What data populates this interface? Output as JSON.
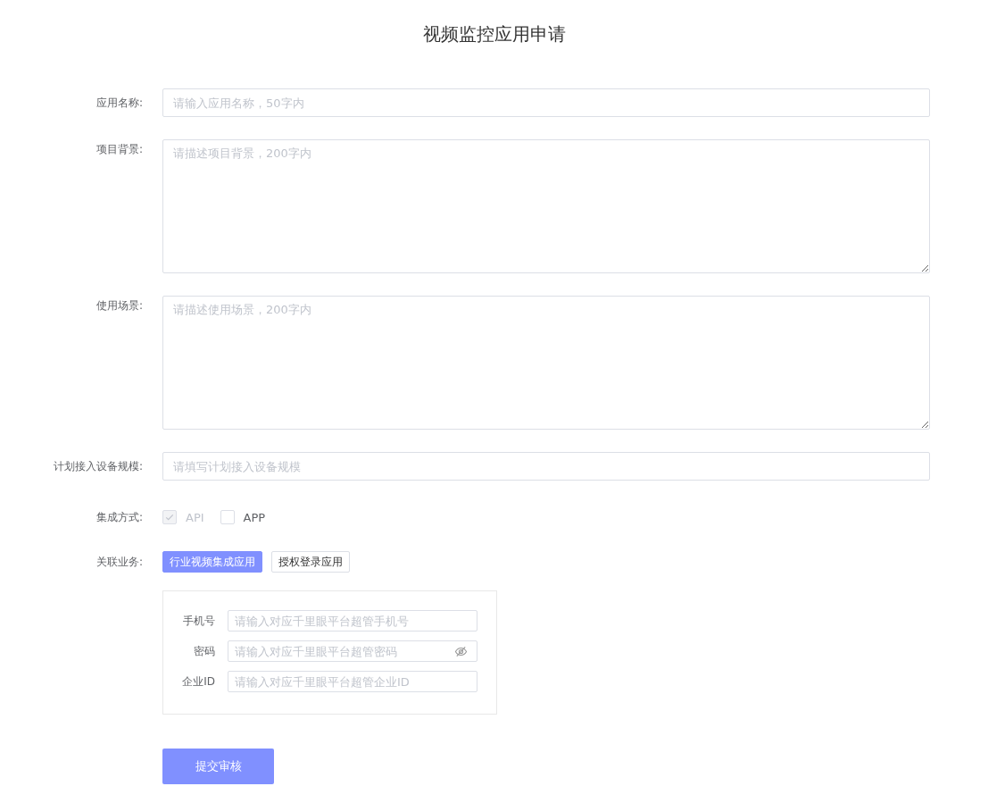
{
  "title": "视频监控应用申请",
  "fields": [
    {
      "kind": "input",
      "label": "应用名称:",
      "placeholder": "请输入应用名称，50字内"
    },
    {
      "kind": "textarea",
      "label": "项目背景:",
      "placeholder": "请描述项目背景，200字内"
    },
    {
      "kind": "textarea",
      "label": "使用场景:",
      "placeholder": "请描述使用场景，200字内"
    },
    {
      "kind": "input",
      "label": "计划接入设备规模:",
      "placeholder": "请填写计划接入设备规模"
    },
    {
      "kind": "checkboxes",
      "label": "集成方式:",
      "options": [
        {
          "label": "API",
          "checked": true,
          "disabled": true
        },
        {
          "label": "APP",
          "checked": false,
          "disabled": false
        }
      ]
    },
    {
      "kind": "tags",
      "label": "关联业务:",
      "options": [
        {
          "label": "行业视频集成应用",
          "selected": true
        },
        {
          "label": "授权登录应用",
          "selected": false
        }
      ]
    }
  ],
  "credentials": [
    {
      "kind": "text",
      "label": "手机号",
      "placeholder": "请输入对应千里眼平台超管手机号"
    },
    {
      "kind": "password",
      "label": "密码",
      "placeholder": "请输入对应千里眼平台超管密码"
    },
    {
      "kind": "text",
      "label": "企业ID",
      "placeholder": "请输入对应千里眼平台超管企业ID"
    }
  ],
  "submit": "提交审核"
}
